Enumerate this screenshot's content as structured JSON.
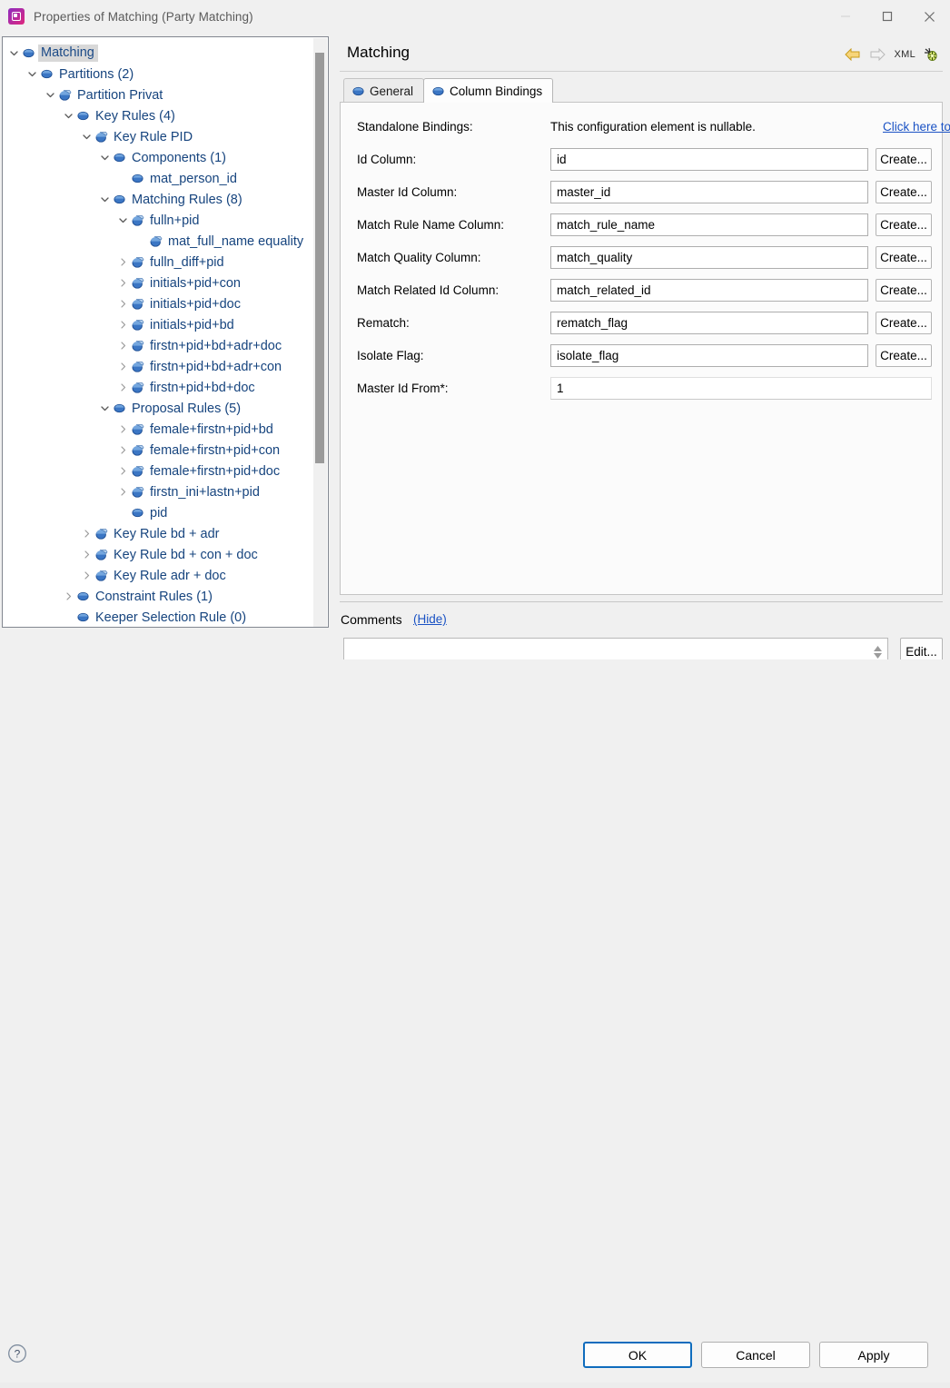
{
  "window": {
    "title": "Properties of Matching (Party Matching)",
    "app_icon": "app-logo-icon",
    "minimize_label": "Minimize",
    "maximize_label": "Maximize",
    "close_label": "Close"
  },
  "tree": {
    "nodes": [
      {
        "label": "Matching",
        "depth": 0,
        "twist": "down",
        "icon": "disc",
        "selected": true
      },
      {
        "label": "Partitions (2)",
        "depth": 1,
        "twist": "down",
        "icon": "disc",
        "selected": false
      },
      {
        "label": "Partition Privat",
        "depth": 2,
        "twist": "down",
        "icon": "sphere",
        "selected": false
      },
      {
        "label": "Key Rules (4)",
        "depth": 3,
        "twist": "down",
        "icon": "disc",
        "selected": false
      },
      {
        "label": "Key Rule PID",
        "depth": 4,
        "twist": "down",
        "icon": "sphere",
        "selected": false
      },
      {
        "label": "Components (1)",
        "depth": 5,
        "twist": "down",
        "icon": "disc",
        "selected": false
      },
      {
        "label": "mat_person_id",
        "depth": 6,
        "twist": "none",
        "icon": "disc",
        "selected": false
      },
      {
        "label": "Matching Rules (8)",
        "depth": 5,
        "twist": "down",
        "icon": "disc",
        "selected": false
      },
      {
        "label": "fulln+pid",
        "depth": 6,
        "twist": "down",
        "icon": "sphere",
        "selected": false
      },
      {
        "label": "mat_full_name equality",
        "depth": 7,
        "twist": "none",
        "icon": "sphere",
        "selected": false
      },
      {
        "label": "fulln_diff+pid",
        "depth": 6,
        "twist": "right",
        "icon": "sphere",
        "selected": false
      },
      {
        "label": "initials+pid+con",
        "depth": 6,
        "twist": "right",
        "icon": "sphere",
        "selected": false
      },
      {
        "label": "initials+pid+doc",
        "depth": 6,
        "twist": "right",
        "icon": "sphere",
        "selected": false
      },
      {
        "label": "initials+pid+bd",
        "depth": 6,
        "twist": "right",
        "icon": "sphere",
        "selected": false
      },
      {
        "label": "firstn+pid+bd+adr+doc",
        "depth": 6,
        "twist": "right",
        "icon": "sphere",
        "selected": false
      },
      {
        "label": "firstn+pid+bd+adr+con",
        "depth": 6,
        "twist": "right",
        "icon": "sphere",
        "selected": false
      },
      {
        "label": "firstn+pid+bd+doc",
        "depth": 6,
        "twist": "right",
        "icon": "sphere",
        "selected": false
      },
      {
        "label": "Proposal Rules (5)",
        "depth": 5,
        "twist": "down",
        "icon": "disc",
        "selected": false
      },
      {
        "label": "female+firstn+pid+bd",
        "depth": 6,
        "twist": "right",
        "icon": "sphere",
        "selected": false
      },
      {
        "label": "female+firstn+pid+con",
        "depth": 6,
        "twist": "right",
        "icon": "sphere",
        "selected": false
      },
      {
        "label": "female+firstn+pid+doc",
        "depth": 6,
        "twist": "right",
        "icon": "sphere",
        "selected": false
      },
      {
        "label": "firstn_ini+lastn+pid",
        "depth": 6,
        "twist": "right",
        "icon": "sphere",
        "selected": false
      },
      {
        "label": "pid",
        "depth": 6,
        "twist": "none",
        "icon": "disc",
        "selected": false
      },
      {
        "label": "Key Rule bd + adr",
        "depth": 4,
        "twist": "right",
        "icon": "sphere",
        "selected": false
      },
      {
        "label": "Key Rule bd + con + doc",
        "depth": 4,
        "twist": "right",
        "icon": "sphere",
        "selected": false
      },
      {
        "label": "Key Rule adr + doc",
        "depth": 4,
        "twist": "right",
        "icon": "sphere",
        "selected": false
      },
      {
        "label": "Constraint Rules (1)",
        "depth": 3,
        "twist": "right",
        "icon": "disc",
        "selected": false
      },
      {
        "label": "Keeper Selection Rule (0)",
        "depth": 3,
        "twist": "none",
        "icon": "disc",
        "selected": false
      }
    ]
  },
  "details": {
    "title": "Matching",
    "toolbar": [
      {
        "name": "back-arrow-icon",
        "label": "Back"
      },
      {
        "name": "forward-arrow-icon",
        "label": "Forward"
      },
      {
        "name": "xml-icon",
        "label": "XML"
      },
      {
        "name": "debug-bug-icon",
        "label": "Debug"
      }
    ],
    "tabs": [
      {
        "label": "General",
        "active": false
      },
      {
        "label": "Column Bindings",
        "active": true
      }
    ],
    "standalone": {
      "label": "Standalone Bindings:",
      "note": "This configuration element is nullable.",
      "link": "Click here to erase it."
    },
    "fields": [
      {
        "label": "Id Column:",
        "value": "id",
        "button": "Create...",
        "wide": false
      },
      {
        "label": "Master Id Column:",
        "value": "master_id",
        "button": "Create...",
        "wide": false
      },
      {
        "label": "Match Rule Name Column:",
        "value": "match_rule_name",
        "button": "Create...",
        "wide": false
      },
      {
        "label": "Match Quality Column:",
        "value": "match_quality",
        "button": "Create...",
        "wide": false
      },
      {
        "label": "Match Related Id Column:",
        "value": "match_related_id",
        "button": "Create...",
        "wide": false
      },
      {
        "label": "Rematch:",
        "value": "rematch_flag",
        "button": "Create...",
        "wide": false
      },
      {
        "label": "Isolate Flag:",
        "value": "isolate_flag",
        "button": "Create...",
        "wide": false
      },
      {
        "label": "Master Id From*:",
        "value": "1",
        "button": "",
        "wide": true
      }
    ],
    "comments": {
      "label": "Comments",
      "toggle": "(Hide)",
      "value": "",
      "edit_label": "Edit..."
    }
  },
  "footer": {
    "help_icon": "help-icon",
    "ok_label": "OK",
    "cancel_label": "Cancel",
    "apply_label": "Apply"
  },
  "colors": {
    "tree_text": "#16447e",
    "link": "#1a52c4",
    "accent": "#0f6cbd",
    "selection": "#d8d8d8"
  }
}
